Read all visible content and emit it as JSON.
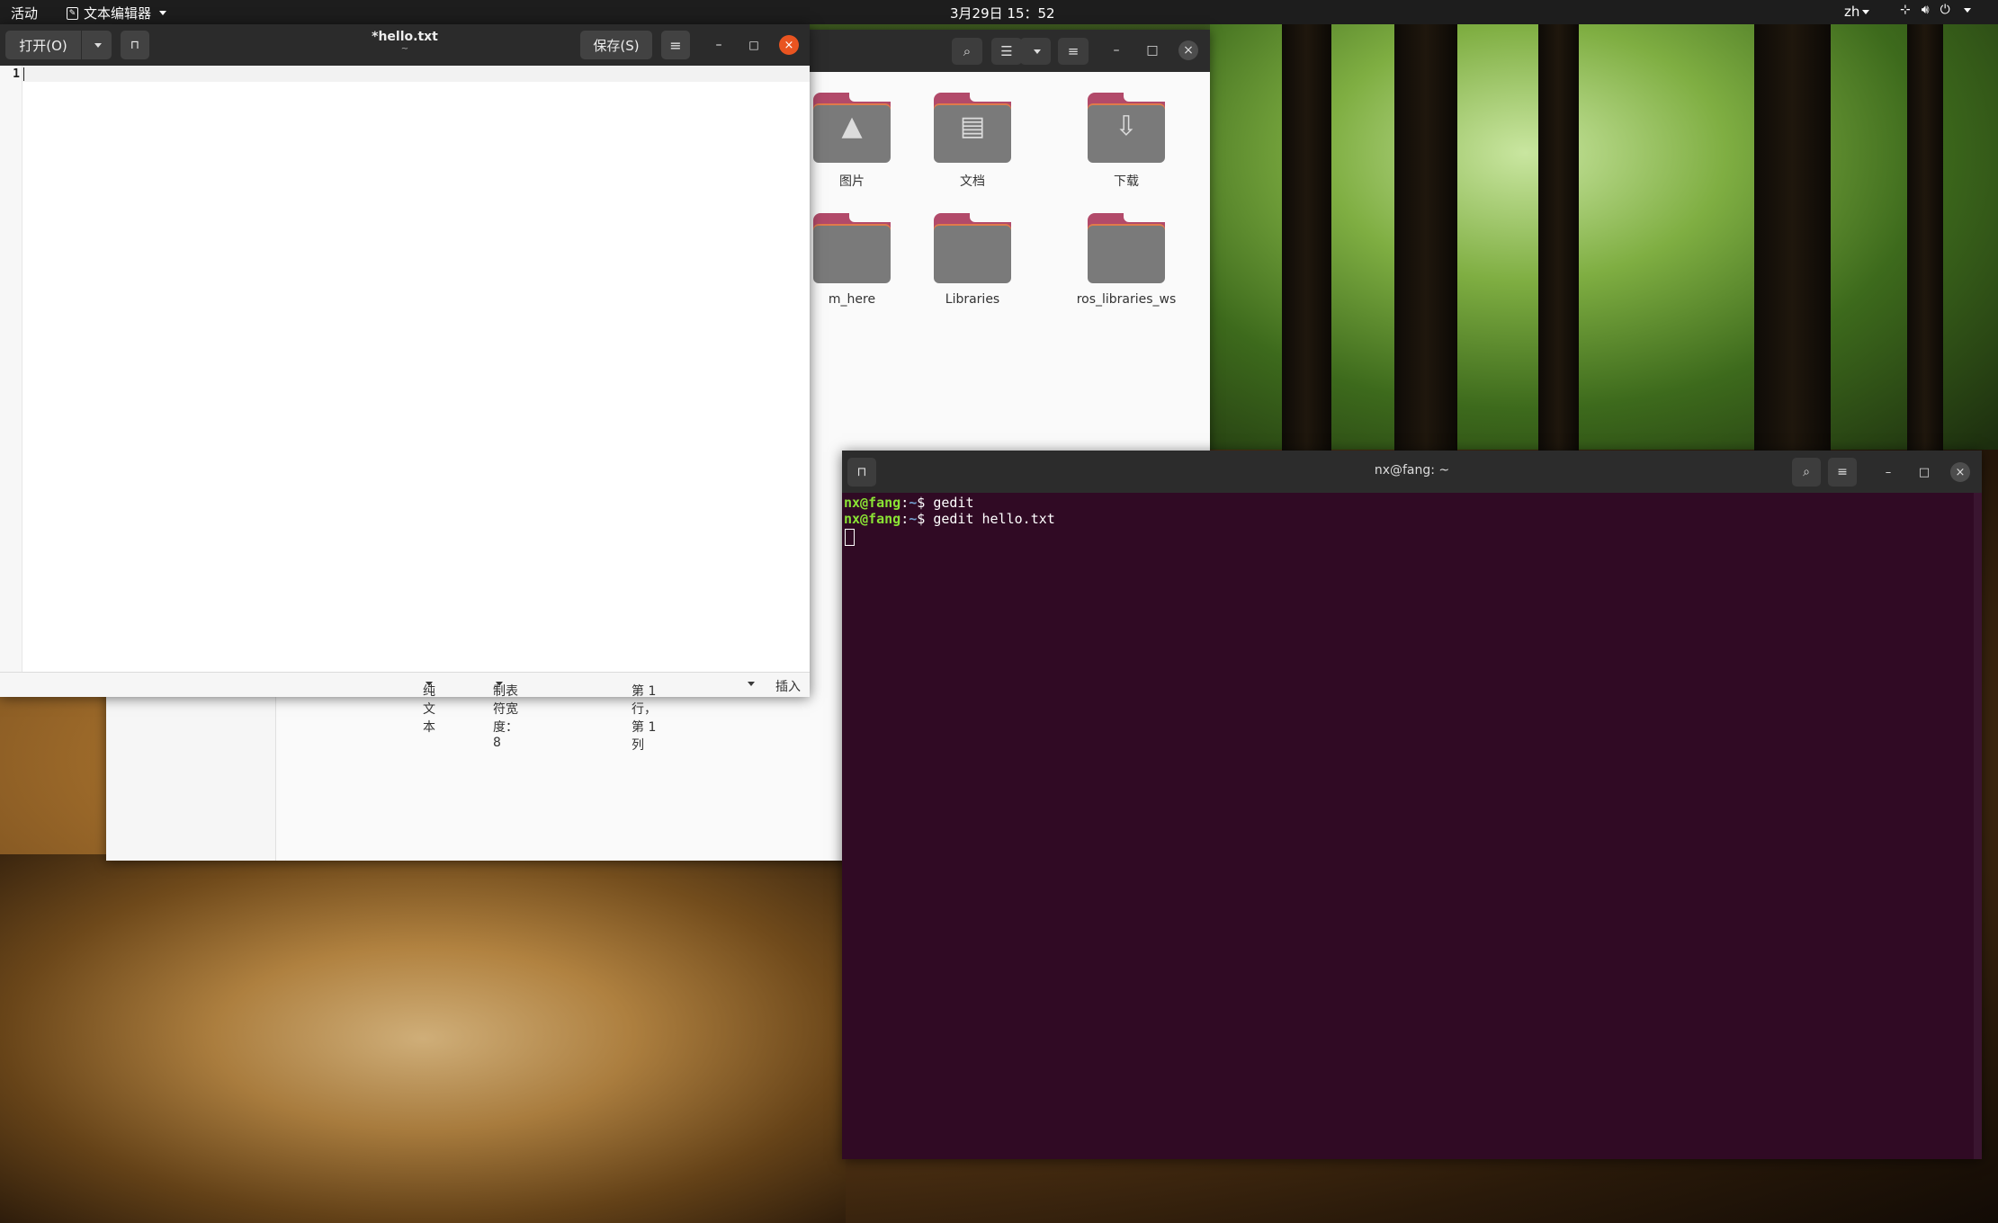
{
  "topbar": {
    "activities": "活动",
    "app_menu": "文本编辑器",
    "clock": "3月29日  15：52",
    "lang": "zh"
  },
  "file_manager": {
    "folders": [
      {
        "label": "图片",
        "glyph": "picture"
      },
      {
        "label": "文档",
        "glyph": "document"
      },
      {
        "label": "下载",
        "glyph": "download"
      },
      {
        "label": "m_here",
        "glyph": "folder"
      },
      {
        "label": "Libraries",
        "glyph": "folder"
      },
      {
        "label": "ros_libraries_ws",
        "glyph": "folder"
      }
    ]
  },
  "gedit": {
    "open_label": "打开(O)",
    "title": "*hello.txt",
    "subtitle": "~",
    "save_label": "保存(S)",
    "line_number": "1",
    "status": {
      "language": "纯文本",
      "tab_width": "制表符宽度：8",
      "position": "第 1 行，第 1 列",
      "mode": "插入"
    }
  },
  "terminal": {
    "title": "nx@fang: ~",
    "lines": [
      {
        "user": "nx@fang",
        "path": "~",
        "cmd": "gedit"
      },
      {
        "user": "nx@fang",
        "path": "~",
        "cmd": "gedit hello.txt"
      }
    ]
  },
  "colors": {
    "accent_close": "#e95420",
    "terminal_bg": "#300a24",
    "prompt_user": "#8ae234",
    "prompt_path": "#729fcf",
    "folder_tab": "#b24a6a"
  }
}
